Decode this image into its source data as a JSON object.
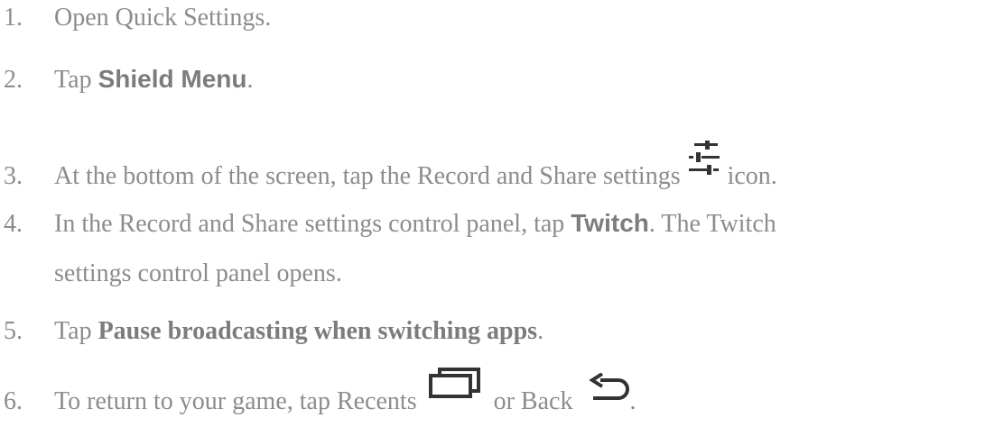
{
  "steps": [
    {
      "number": "1.",
      "text": "Open Quick Settings."
    },
    {
      "number": "2.",
      "prefix": "Tap ",
      "bold": "Shield Menu",
      "suffix": "."
    },
    {
      "number": "3.",
      "prefix": "At the bottom of the screen, tap the Record and Share settings ",
      "icon": "sliders-icon",
      "suffix": " icon."
    },
    {
      "number": "4.",
      "prefix": "In the Record and Share settings control panel, tap ",
      "bold": "Twitch",
      "suffix": ". The Twitch",
      "continuation": "settings control panel opens."
    },
    {
      "number": "5.",
      "prefix": "Tap ",
      "bold": "Pause broadcasting when switching apps",
      "suffix": "."
    },
    {
      "number": "6.",
      "prefix": "To return to your game, tap Recents ",
      "icon_recents": "recents-icon",
      "middle": "  or Back ",
      "icon_back": "back-icon",
      "suffix": "."
    }
  ]
}
